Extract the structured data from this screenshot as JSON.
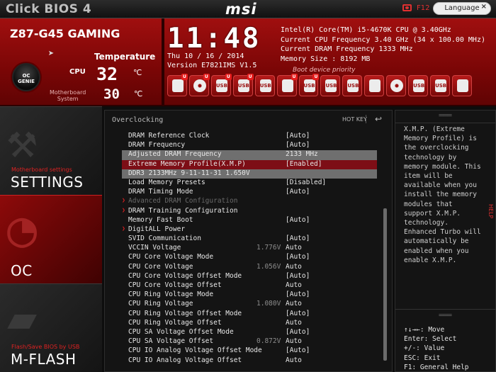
{
  "titlebar": {
    "app_title": "Click BIOS 4",
    "brand": "msi",
    "screenshot_key": "F12",
    "language_label": "Language",
    "close_glyph": "×"
  },
  "header": {
    "board_name": "Z87-G45 GAMING",
    "temperature_title": "Temperature",
    "cpu_label": "CPU",
    "cpu_temp": "32",
    "temp_unit": "℃",
    "mb_label_line1": "Motherboard",
    "mb_label_line2": "System",
    "mb_temp": "30",
    "oc_genie_line1": "OC",
    "oc_genie_line2": "GENIE",
    "clock": "11:48",
    "date": "Thu  10 / 16 / 2014",
    "version": "Version E7821IMS V1.5",
    "sysinfo": [
      "Intel(R) Core(TM) i5-4670K CPU @ 3.40GHz",
      "Current CPU Frequency 3.40 GHz (34 x 100.00 MHz)",
      "Current DRAM Frequency 1333 MHz",
      "Memory Size : 8192 MB"
    ],
    "boot_priority_label": "Boot device priority",
    "boot_devices": [
      {
        "icon": "hdd-icon",
        "text": "",
        "badge": "U",
        "kind": "plain"
      },
      {
        "icon": "disc-icon",
        "text": "",
        "badge": "U",
        "kind": "disc"
      },
      {
        "icon": "usb-icon",
        "text": "USB",
        "badge": "U",
        "kind": "box"
      },
      {
        "icon": "usb-icon",
        "text": "USB",
        "badge": "U",
        "kind": "box"
      },
      {
        "icon": "usb-icon",
        "text": "USB",
        "badge": "",
        "kind": "box"
      },
      {
        "icon": "card-icon",
        "text": "",
        "badge": "U",
        "kind": "box"
      },
      {
        "icon": "usb-icon",
        "text": "USB",
        "badge": "U",
        "kind": "box"
      },
      {
        "icon": "usb-icon",
        "text": "USB",
        "badge": "",
        "kind": "box"
      },
      {
        "icon": "usb-icon",
        "text": "USB",
        "badge": "",
        "kind": "box"
      },
      {
        "icon": "hdd-icon",
        "text": "",
        "badge": "",
        "kind": "plain"
      },
      {
        "icon": "disc-icon",
        "text": "",
        "badge": "",
        "kind": "disc"
      },
      {
        "icon": "usb-icon",
        "text": "USB",
        "badge": "",
        "kind": "box"
      },
      {
        "icon": "usb-icon",
        "text": "USB",
        "badge": "",
        "kind": "box"
      },
      {
        "icon": "drive-icon",
        "text": "",
        "badge": "",
        "kind": "box"
      }
    ]
  },
  "nav": {
    "settings_caption": "Motherboard settings",
    "settings_title": "SETTINGS",
    "oc_title": "OC",
    "mflash_caption": "Flash/Save BIOS by USB",
    "mflash_title": "M-FLASH"
  },
  "panel": {
    "title": "Overclocking",
    "hotkey_label": "HOT KEY",
    "back_glyph": "↩",
    "rows": [
      {
        "label": "DRAM Reference Clock",
        "mid": "",
        "value": "[Auto]",
        "style": ""
      },
      {
        "label": "DRAM Frequency",
        "mid": "",
        "value": "[Auto]",
        "style": ""
      },
      {
        "label": "Adjusted DRAM Frequency",
        "mid": "",
        "value": "2133 MHz",
        "style": "highlight dim"
      },
      {
        "label": "Extreme Memory Profile(X.M.P)",
        "mid": "",
        "value": "[Enabled]",
        "style": "selected"
      },
      {
        "label": "DDR3 2133MHz 9-11-11-31 1.650V",
        "mid": "",
        "value": "",
        "style": "highlight dim"
      },
      {
        "label": "Load Memory Presets",
        "mid": "",
        "value": "[Disabled]",
        "style": ""
      },
      {
        "label": "DRAM Timing Mode",
        "mid": "",
        "value": "[Auto]",
        "style": ""
      },
      {
        "label": "Advanced DRAM Configuration",
        "mid": "",
        "value": "",
        "style": "disabled",
        "arrow": "❯"
      },
      {
        "label": "DRAM Training Configuration",
        "mid": "",
        "value": "",
        "style": "",
        "arrow": "❯"
      },
      {
        "label": "Memory Fast Boot",
        "mid": "",
        "value": "[Auto]",
        "style": ""
      },
      {
        "label": "DigitALL Power",
        "mid": "",
        "value": "",
        "style": "",
        "arrow": "❯"
      },
      {
        "label": "SVID Communication",
        "mid": "",
        "value": "[Auto]",
        "style": ""
      },
      {
        "label": "VCCIN Voltage",
        "mid": "1.776V",
        "value": "Auto",
        "style": ""
      },
      {
        "label": "CPU Core Voltage Mode",
        "mid": "",
        "value": "[Auto]",
        "style": ""
      },
      {
        "label": "CPU Core Voltage",
        "mid": "1.056V",
        "value": "Auto",
        "style": ""
      },
      {
        "label": "CPU Core Voltage Offset Mode",
        "mid": "",
        "value": "[Auto]",
        "style": ""
      },
      {
        "label": "CPU Core Voltage Offset",
        "mid": "",
        "value": "Auto",
        "style": ""
      },
      {
        "label": "CPU Ring Voltage Mode",
        "mid": "",
        "value": "[Auto]",
        "style": ""
      },
      {
        "label": "CPU Ring Voltage",
        "mid": "1.080V",
        "value": "Auto",
        "style": ""
      },
      {
        "label": "CPU Ring Voltage Offset Mode",
        "mid": "",
        "value": "[Auto]",
        "style": ""
      },
      {
        "label": "CPU Ring Voltage Offset",
        "mid": "",
        "value": "Auto",
        "style": ""
      },
      {
        "label": "CPU SA Voltage Offset Mode",
        "mid": "",
        "value": "[Auto]",
        "style": ""
      },
      {
        "label": "CPU SA Voltage Offset",
        "mid": "0.872V",
        "value": "Auto",
        "style": ""
      },
      {
        "label": "CPU IO Analog Voltage Offset Mode",
        "mid": "",
        "value": "[Auto]",
        "style": ""
      },
      {
        "label": "CPU IO Analog Voltage Offset",
        "mid": "",
        "value": "Auto",
        "style": ""
      }
    ]
  },
  "help": {
    "text": "X.M.P. (Extreme\nMemory Profile) is\nthe overclocking\ntechnology by\nmemory module. This\nitem will be\navailable when you\ninstall the memory\nmodules that\nsupport X.M.P.\ntechnology.\nEnhanced Turbo will\nautomatically be\nenabled when you\nenable X.M.P.",
    "keys": "↑↓→←: Move\nEnter: Select\n+/-: Value\nESC: Exit\nF1: General Help",
    "side_tab": "HELP"
  },
  "colors": {
    "accent_red": "#a00f0f",
    "selected_row": "#7d0e16",
    "highlight_row": "#6f6f6f"
  }
}
